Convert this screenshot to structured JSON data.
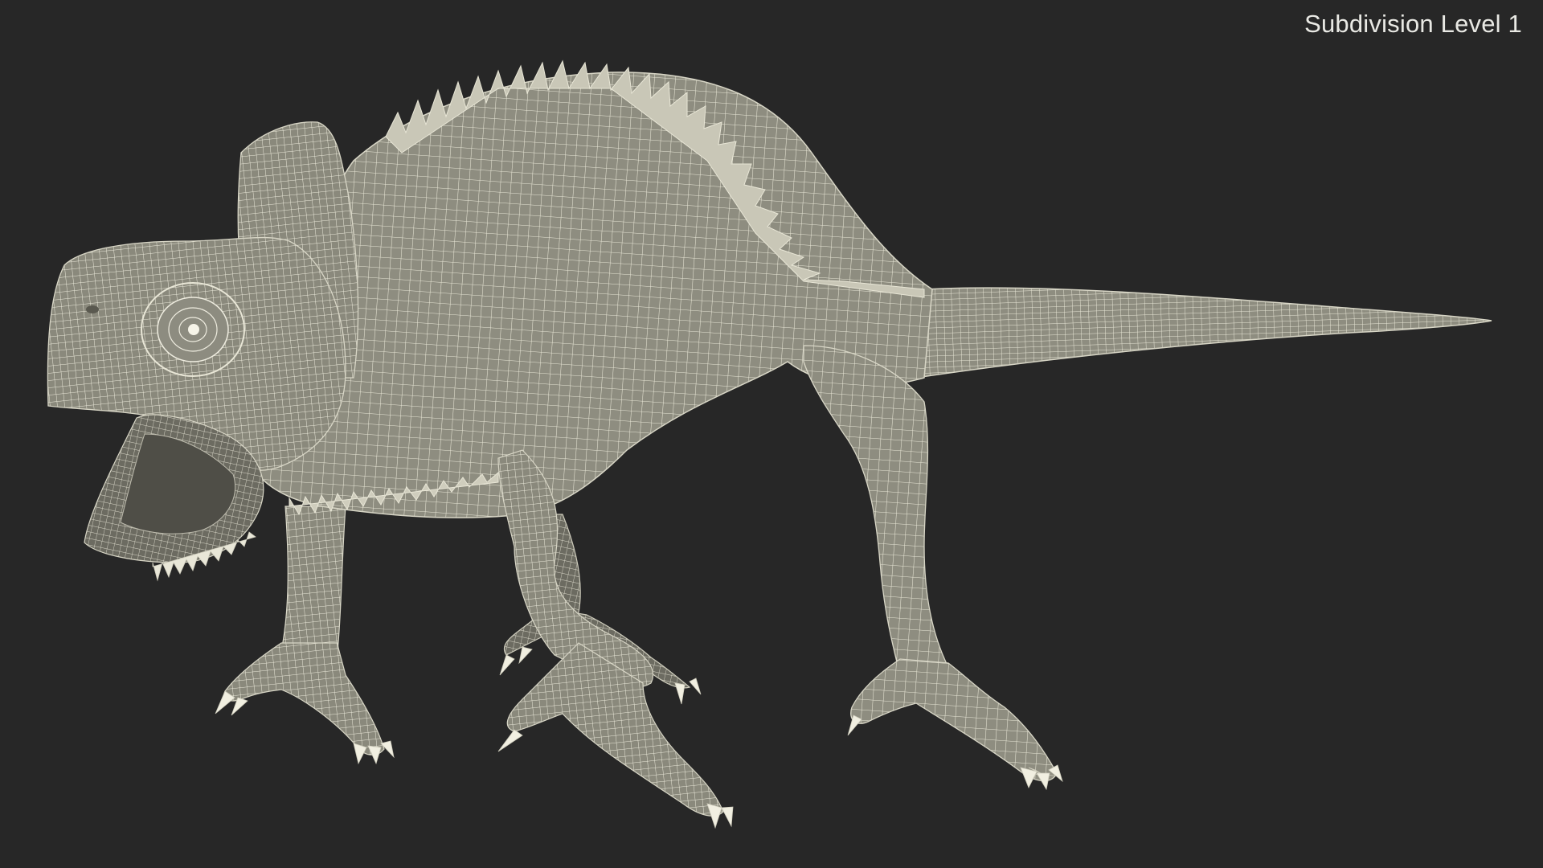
{
  "viewport": {
    "caption": "Subdivision Level 1"
  },
  "colors": {
    "background": "#272727",
    "mesh_fill": "#8e8d80",
    "mesh_fill_dark": "#6c6b61",
    "wire": "#e8e6d6",
    "caption_text": "#e9e9e4"
  },
  "model": {
    "subject": "chameleon",
    "display_mode": "wireframe-on-shaded"
  }
}
